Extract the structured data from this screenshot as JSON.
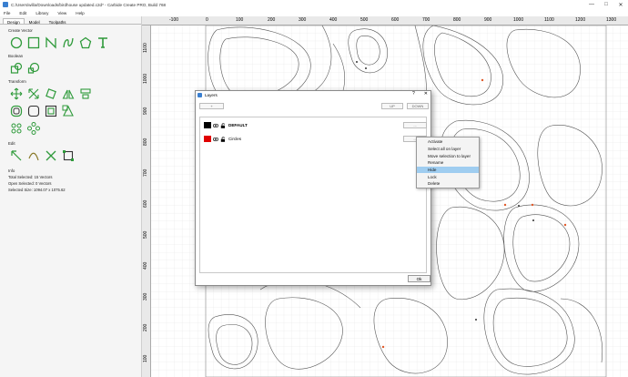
{
  "window": {
    "title": "C:/Users/willa/Downloads/birdhouse updated.c2d* - Carbide Create PRO, Build 768",
    "minimize": "—",
    "maximize": "□",
    "close": "✕"
  },
  "menu": [
    "File",
    "Edit",
    "Library",
    "View",
    "Help"
  ],
  "sidebar": {
    "tabs": [
      "Design",
      "Model",
      "Toolpaths"
    ],
    "sections": {
      "create_vector": "Create Vector",
      "boolean": "Boolean",
      "transform": "Transform",
      "edit": "Edit",
      "info": "Info"
    },
    "info": {
      "total_selected": "Total Selected: 15 Vectors",
      "open_selected": "Open Selected: 0 Vectors",
      "selected_size": "Selected Size: 1094.07 x 1075.62"
    },
    "icon_names": [
      "circle-tool-icon",
      "rectangle-tool-icon",
      "polyline-tool-icon",
      "curve-tool-icon",
      "polygon-tool-icon",
      "text-tool-icon"
    ]
  },
  "ruler": {
    "top": [
      "-100",
      "0",
      "100",
      "200",
      "300",
      "400",
      "500",
      "600",
      "700",
      "800",
      "900",
      "1000",
      "1100",
      "1200",
      "1300"
    ],
    "left": [
      "1100",
      "1000",
      "900",
      "800",
      "700",
      "600",
      "500",
      "400",
      "300",
      "200",
      "100"
    ]
  },
  "dialog": {
    "title": "Layers",
    "help": "?",
    "close": "✕",
    "add_label": "+",
    "up_label": "UP",
    "down_label": "DOWN",
    "more_label": "...",
    "ok_label": "Ok",
    "layers": [
      {
        "name": "DEFAULT",
        "color": "#000000",
        "bold": true
      },
      {
        "name": "Circles",
        "color": "#e00000",
        "bold": false
      }
    ]
  },
  "context_menu": {
    "items": [
      "Activate",
      "Select all on layer",
      "Move selection to layer",
      "Rename",
      "Hide",
      "Lock",
      "Delete"
    ],
    "highlighted": "Hide"
  },
  "colors": {
    "accent": "#3a7fd0",
    "tool_green": "#2e9a3a",
    "highlight": "#9fcdf0",
    "marker_red": "#e05a2a"
  }
}
